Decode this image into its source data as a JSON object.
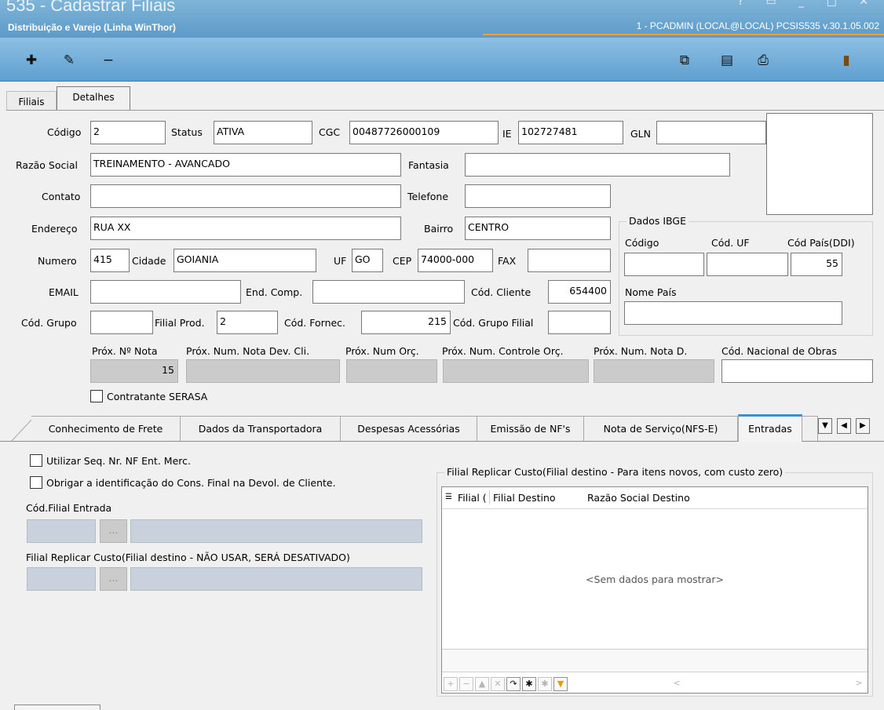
{
  "window": {
    "title": "535 - Cadastrar Filiais",
    "subtitle": "Distribuição e Varejo (Linha WinThor)",
    "session": "1 - PCADMIN (LOCAL@LOCAL)   PCSIS535  v.30.1.05.002",
    "controls": "? ▭ _ □ ✕"
  },
  "toolbar": {
    "icons": [
      "add-icon",
      "edit-icon",
      "remove-icon",
      "copy-icon",
      "notes-icon",
      "print-icon",
      "exit-icon"
    ],
    "add": "✚",
    "edit": "✎",
    "remove": "−",
    "copy": "⧉",
    "notes": "▤",
    "print": "⎙",
    "exit": "▮"
  },
  "tabs": {
    "filiais": "Filiais",
    "detalhes": "Detalhes"
  },
  "form": {
    "codigo": {
      "label": "Código",
      "value": "2"
    },
    "status": {
      "label": "Status",
      "value": "ATIVA"
    },
    "cgc": {
      "label": "CGC",
      "value": "00487726000109"
    },
    "ie": {
      "label": "IE",
      "value": "102727481"
    },
    "gln": {
      "label": "GLN",
      "value": ""
    },
    "razao_social": {
      "label": "Razão Social",
      "value": "TREINAMENTO - AVANCADO"
    },
    "fantasia": {
      "label": "Fantasia",
      "value": ""
    },
    "contato": {
      "label": "Contato",
      "value": ""
    },
    "telefone": {
      "label": "Telefone",
      "value": ""
    },
    "endereco": {
      "label": "Endereço",
      "value": "RUA XX"
    },
    "bairro": {
      "label": "Bairro",
      "value": "CENTRO"
    },
    "numero": {
      "label": "Numero",
      "value": "415"
    },
    "cidade": {
      "label": "Cidade",
      "value": "GOIANIA"
    },
    "uf": {
      "label": "UF",
      "value": "GO"
    },
    "cep": {
      "label": "CEP",
      "value": "74000-000"
    },
    "fax": {
      "label": "FAX",
      "value": ""
    },
    "email": {
      "label": "EMAIL",
      "value": ""
    },
    "end_comp": {
      "label": "End. Comp.",
      "value": ""
    },
    "cod_cliente": {
      "label": "Cód. Cliente",
      "value": "654400"
    },
    "cod_grupo": {
      "label": "Cód. Grupo",
      "value": ""
    },
    "filial_prod": {
      "label": "Filial Prod.",
      "value": "2"
    },
    "cod_fornec": {
      "label": "Cód. Fornec.",
      "value": "215"
    },
    "cod_grupo_filial": {
      "label": "Cód. Grupo Filial",
      "value": ""
    }
  },
  "ibge": {
    "title": "Dados IBGE",
    "codigo": {
      "label": "Código",
      "value": ""
    },
    "cod_uf": {
      "label": "Cód. UF",
      "value": ""
    },
    "cod_pais": {
      "label": "Cód País(DDI)",
      "value": "55"
    },
    "nome_pais": {
      "label": "Nome País",
      "value": ""
    }
  },
  "counters": {
    "prox_nota": {
      "label": "Próx. Nº Nota",
      "value": "15"
    },
    "prox_nota_dev": {
      "label": "Próx. Num. Nota Dev. Cli.",
      "value": ""
    },
    "prox_orc": {
      "label": "Próx. Num Orç.",
      "value": ""
    },
    "prox_controle_orc": {
      "label": "Próx. Num. Controle Orç.",
      "value": ""
    },
    "prox_nota_d": {
      "label": "Próx. Num. Nota D.",
      "value": ""
    },
    "cod_obras": {
      "label": "Cód. Nacional de Obras",
      "value": ""
    }
  },
  "contratante_serasa": {
    "label": "Contratante SERASA",
    "checked": false
  },
  "subtabs": [
    "Conhecimento de Frete",
    "Dados da Transportadora",
    "Despesas Acessórias",
    "Emissão de NF's",
    "Nota de Serviço(NFS-E)",
    "Entradas"
  ],
  "subtab_nav": {
    "menu": "▼",
    "prev": "◀",
    "next": "▶"
  },
  "entradas": {
    "utilizar_seq": {
      "label": "Utilizar Seq. Nr. NF Ent. Merc.",
      "checked": false
    },
    "obrigar_ident": {
      "label": "Obrigar a identificação do Cons. Final na Devol. de Cliente.",
      "checked": false
    },
    "cod_filial_entrada": {
      "label": "Cód.Filial Entrada",
      "button": "..."
    },
    "filial_replicar_old": {
      "label": "Filial Replicar Custo(Filial destino - NÃO USAR, SERÁ DESATIVADO)",
      "button": "..."
    },
    "grid": {
      "title": "Filial Replicar Custo(Filial destino - Para itens novos, com custo zero)",
      "columns": [
        "Filial (",
        "Filial Destino",
        "Razão Social Destino"
      ],
      "empty": "<Sem dados para mostrar>",
      "scroll_left": "<",
      "scroll_right": ">"
    }
  }
}
